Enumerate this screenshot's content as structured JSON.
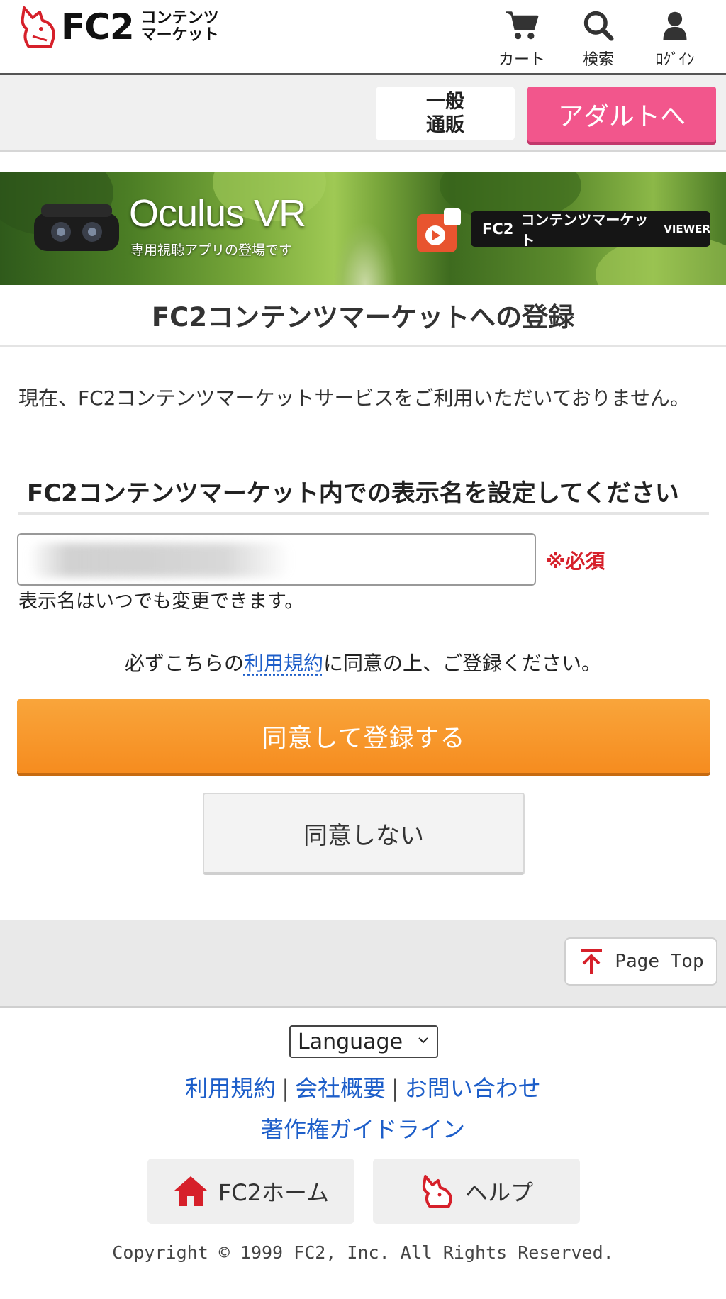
{
  "header": {
    "logo_text": "FC2",
    "logo_sub_line1": "コンテンツ",
    "logo_sub_line2": "マーケット",
    "cart_label": "カート",
    "search_label": "検索",
    "login_label": "ﾛｸﾞｲﾝ"
  },
  "shop_tabs": {
    "general_label": "一般通販",
    "adult_label": "アダルトへ"
  },
  "banner": {
    "title": "Oculus VR",
    "subtitle": "専用視聴アプリの登場です",
    "badge_brand": "FC2",
    "badge_text": "コンテンツマーケット",
    "badge_viewer": "VIEWER"
  },
  "page": {
    "title": "FC2コンテンツマーケットへの登録",
    "notice": "現在、FC2コンテンツマーケットサービスをご利用いただいておりません。",
    "section_title": "FC2コンテンツマーケット内での表示名を設定してください",
    "display_name_value": "",
    "required_label": "※必須",
    "hint": "表示名はいつでも変更できます。",
    "agree_prefix": "必ずこちらの",
    "agree_link": "利用規約",
    "agree_suffix": "に同意の上、ご登録ください。",
    "agree_button": "同意して登録する",
    "disagree_button": "同意しない"
  },
  "page_top": {
    "label": "Page Top"
  },
  "footer": {
    "language_label": "Language",
    "links": [
      "利用規約",
      "会社概要",
      "お問い合わせ"
    ],
    "separator": "|",
    "guideline_link": "著作権ガイドライン",
    "home_button": "FC2ホーム",
    "help_button": "ヘルプ",
    "copyright": "Copyright © 1999 FC2, Inc. All Rights Reserved."
  },
  "colors": {
    "brand_red": "#d6202a",
    "adult_pink": "#f2568c",
    "agree_orange": "#f68c1f",
    "link_blue": "#1d5ec9"
  },
  "icons": [
    "fc2-logo-icon",
    "cart-icon",
    "search-icon",
    "user-icon",
    "vr-goggles-icon",
    "viewer-app-icon",
    "arrow-up-icon",
    "chevron-down-icon",
    "home-icon",
    "help-fc2-icon"
  ]
}
